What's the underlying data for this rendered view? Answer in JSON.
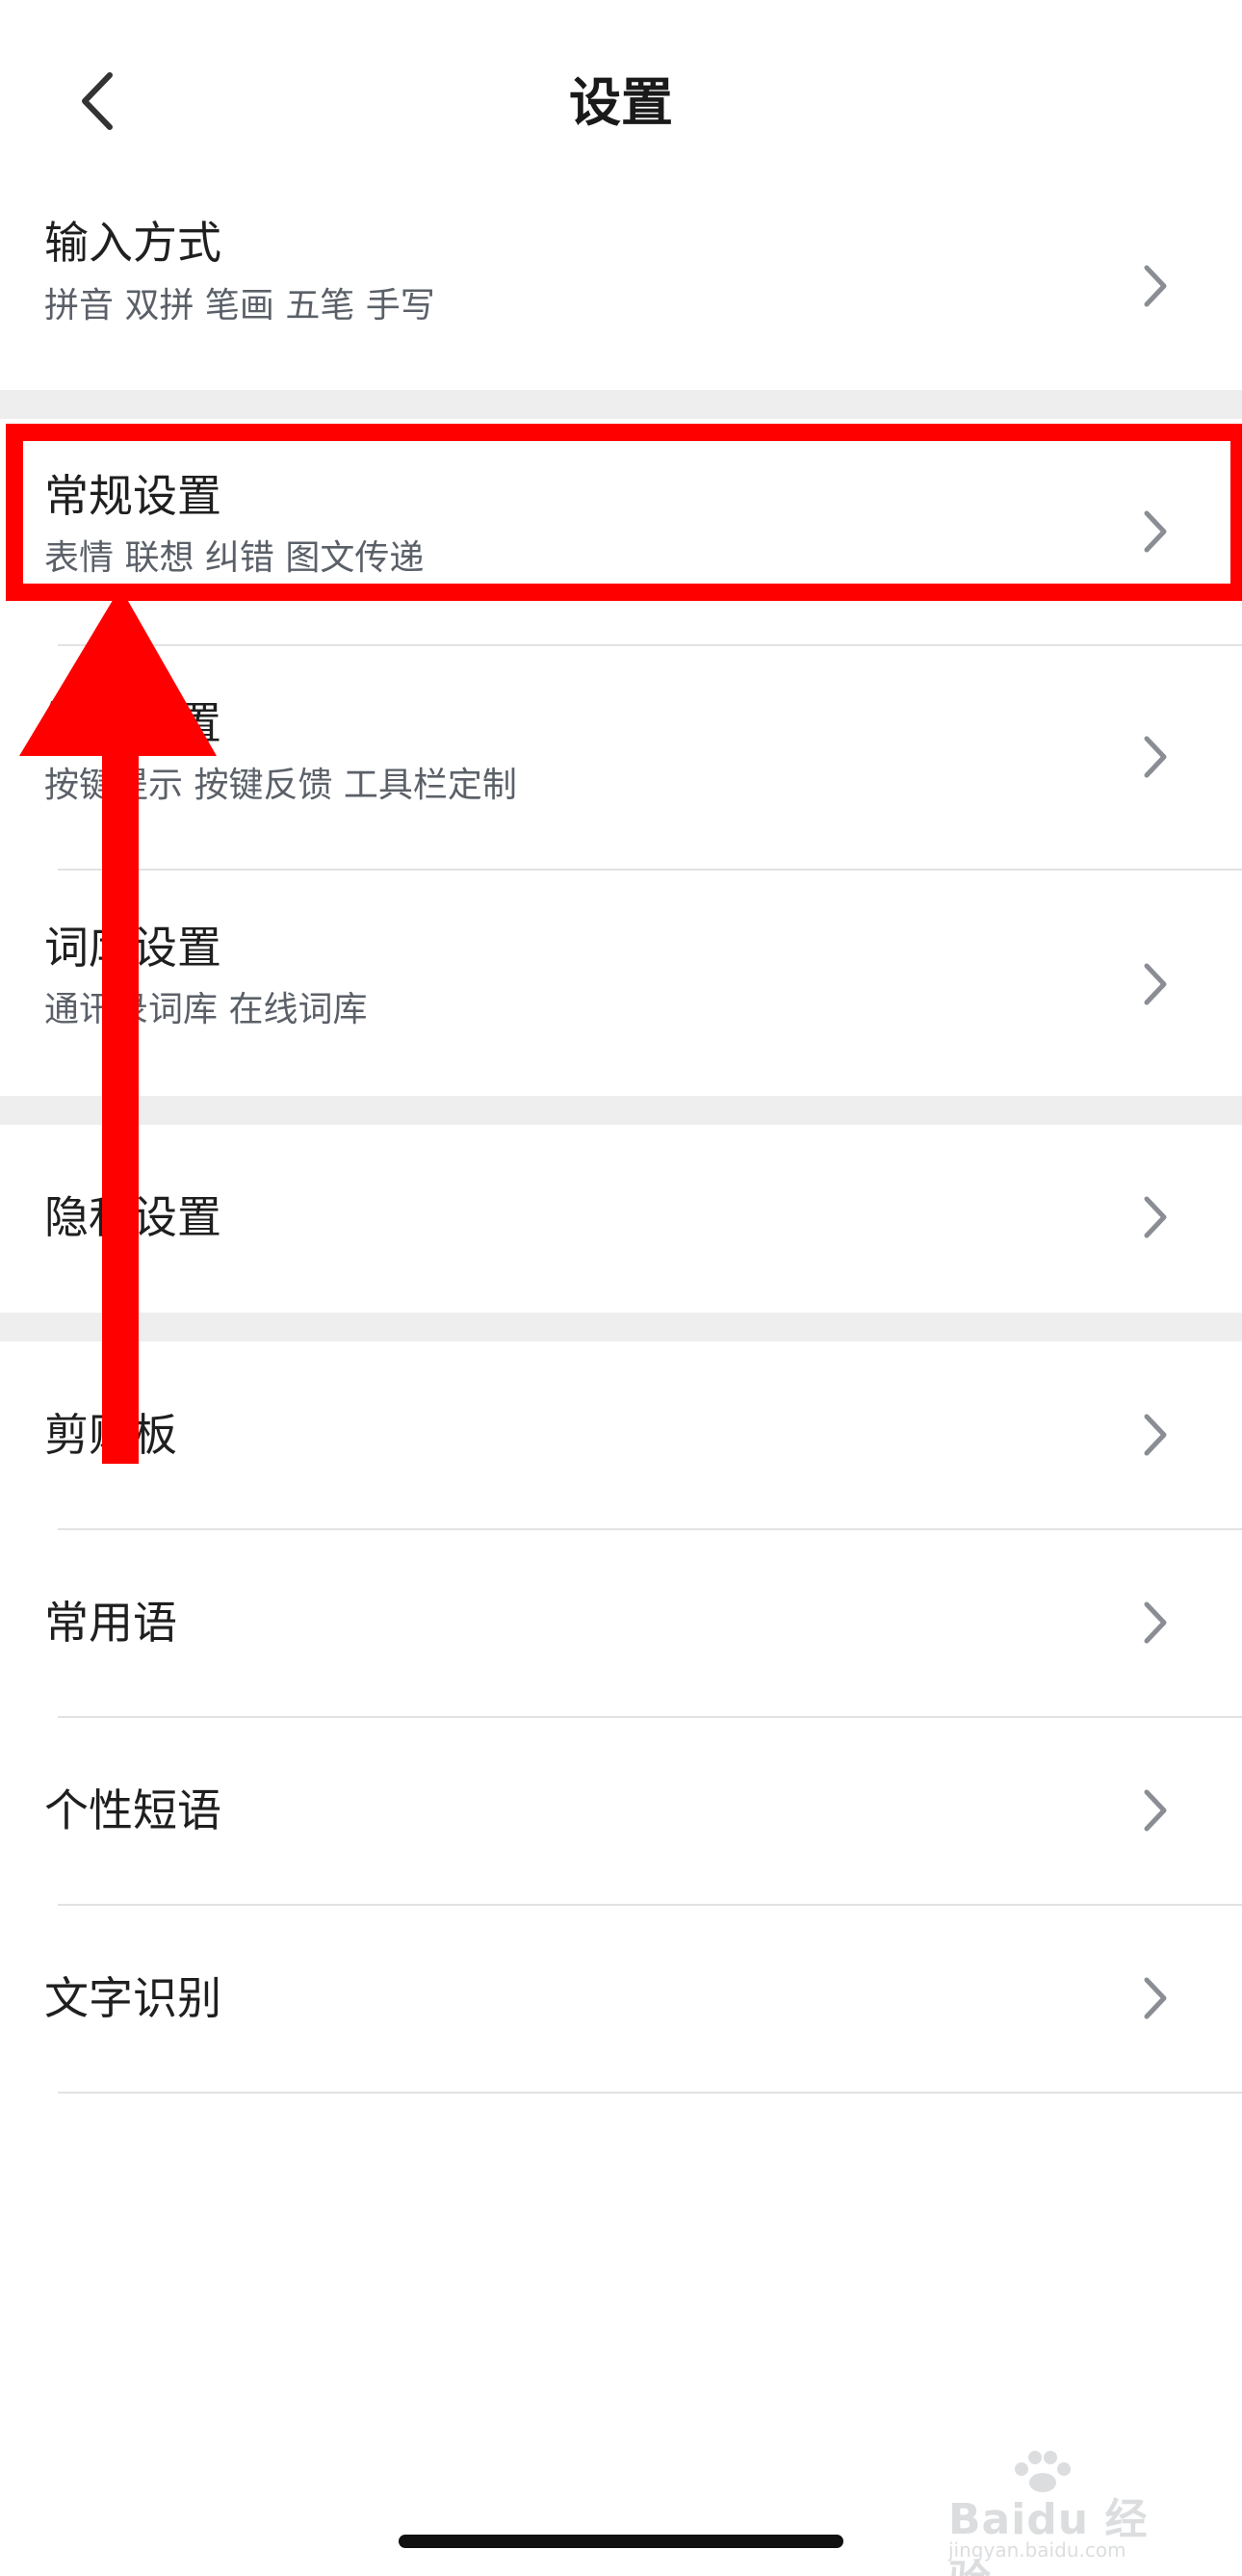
{
  "header": {
    "title": "设置",
    "back_icon": "chevron-left-icon"
  },
  "settings": {
    "input_method": {
      "title": "输入方式",
      "subtitle": "拼音 双拼 笔画 五笔 手写"
    },
    "general": {
      "title": "常规设置",
      "subtitle": "表情 联想 纠错 图文传递"
    },
    "keyboard": {
      "title": "键盘设置",
      "subtitle": "按键提示 按键反馈 工具栏定制"
    },
    "dictionary": {
      "title": "词库设置",
      "subtitle": "通讯录词库 在线词库"
    },
    "privacy": {
      "title": "隐私设置"
    },
    "clipboard": {
      "title": "剪贴板"
    },
    "phrases": {
      "title": "常用语"
    },
    "custom_phrases": {
      "title": "个性短语"
    },
    "ocr": {
      "title": "文字识别"
    }
  },
  "watermark": {
    "text": "Baidu 经验",
    "url": "jingyan.baidu.com"
  },
  "colors": {
    "annotation": "#ff0000",
    "section_gap": "#eeeeee",
    "chevron": "#8a8d94"
  }
}
